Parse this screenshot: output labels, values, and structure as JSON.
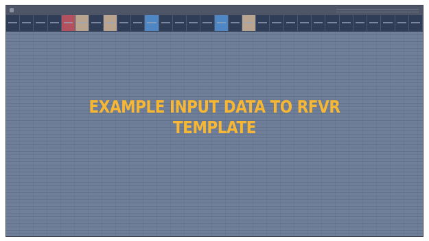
{
  "overlay": {
    "title_line_1": "EXAMPLE INPUT DATA TO RFVR",
    "title_line_2": "TEMPLATE"
  },
  "colors": {
    "grid_background": "#6f7e99",
    "header_background": "#2f3d57",
    "overlay_text": "#f7b733",
    "header_highlight_red": "#b4515f",
    "header_highlight_tan": "#b9a58f",
    "header_highlight_blue": "#4f86c4"
  },
  "header_columns": [
    {
      "style": "plain"
    },
    {
      "style": "plain"
    },
    {
      "style": "plain"
    },
    {
      "style": "plain"
    },
    {
      "style": "red"
    },
    {
      "style": "tan"
    },
    {
      "style": "plain"
    },
    {
      "style": "tan"
    },
    {
      "style": "plain"
    },
    {
      "style": "plain"
    },
    {
      "style": "blue"
    },
    {
      "style": "plain"
    },
    {
      "style": "plain"
    },
    {
      "style": "plain"
    },
    {
      "style": "plain"
    },
    {
      "style": "blue"
    },
    {
      "style": "plain"
    },
    {
      "style": "tan"
    },
    {
      "style": "plain"
    },
    {
      "style": "plain"
    },
    {
      "style": "plain"
    },
    {
      "style": "plain"
    },
    {
      "style": "plain"
    },
    {
      "style": "plain"
    },
    {
      "style": "plain"
    },
    {
      "style": "plain"
    },
    {
      "style": "plain"
    },
    {
      "style": "plain"
    },
    {
      "style": "plain"
    },
    {
      "style": "plain"
    }
  ]
}
